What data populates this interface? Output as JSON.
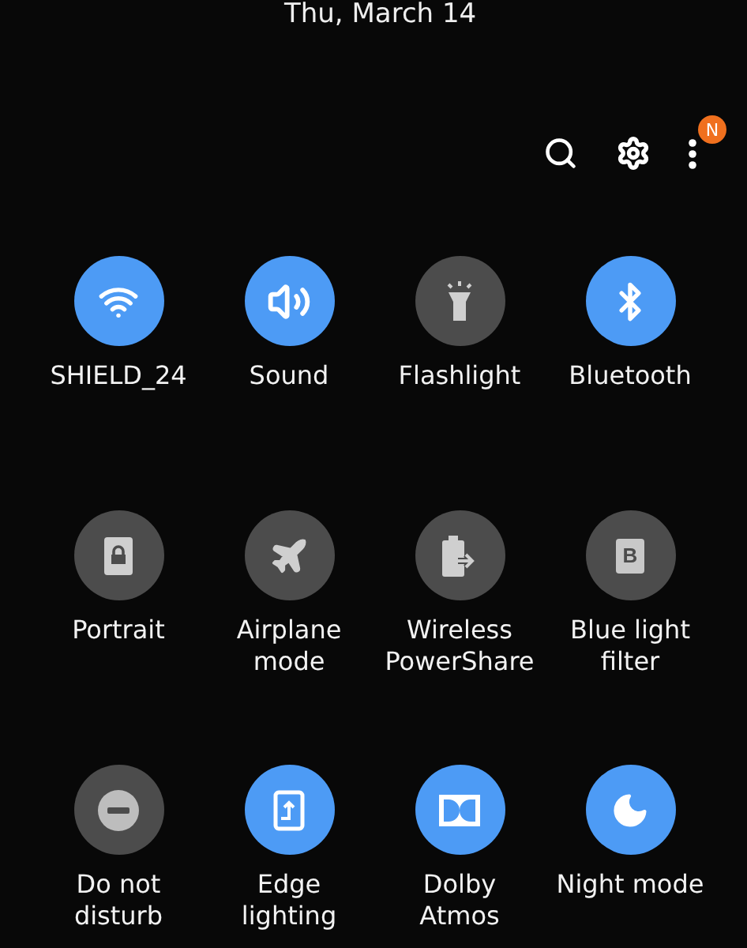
{
  "date": "Thu, March 14",
  "header_actions": [
    {
      "kind": "search"
    },
    {
      "kind": "settings"
    },
    {
      "kind": "more",
      "badge": "N"
    }
  ],
  "tiles": [
    {
      "label": "SHIELD_24",
      "kind": "wifi",
      "on": true
    },
    {
      "label": "Sound",
      "kind": "sound",
      "on": true
    },
    {
      "label": "Flashlight",
      "kind": "flashlight",
      "on": false
    },
    {
      "label": "Bluetooth",
      "kind": "bluetooth",
      "on": true
    },
    {
      "label": "Portrait",
      "kind": "portrait",
      "on": false
    },
    {
      "label": "Airplane mode",
      "kind": "airplane",
      "on": false
    },
    {
      "label": "Wireless PowerShare",
      "kind": "powershare",
      "on": false
    },
    {
      "label": "Blue light filter",
      "kind": "bluelight",
      "on": false,
      "glyph": "B"
    },
    {
      "label": "Do not disturb",
      "kind": "dnd",
      "on": false
    },
    {
      "label": "Edge lighting",
      "kind": "edge",
      "on": true
    },
    {
      "label": "Dolby Atmos",
      "kind": "dolby",
      "on": true
    },
    {
      "label": "Night mode",
      "kind": "night",
      "on": true
    }
  ]
}
